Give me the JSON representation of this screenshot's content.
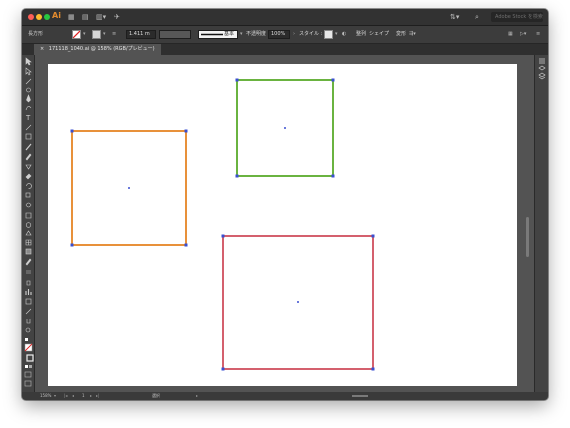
{
  "titlebar": {
    "app_logo": "Ai",
    "search_placeholder": "Adobe Stock を検索"
  },
  "control_bar": {
    "selection_label": "長方形",
    "stroke_weight": "1.411 m",
    "stroke_style": "基本",
    "opacity_label": "不透明度 :",
    "opacity_value": "100%",
    "style_label": "スタイル :",
    "align_label": "整列",
    "shape_label": "シェイプ",
    "transform_label": "変形"
  },
  "document": {
    "tab_title": "171118_1040.ai @ 158% (RGB/プレビュー)",
    "close_glyph": "×"
  },
  "status_bar": {
    "zoom": "158%",
    "artboard_number": "1",
    "tool_name": "選択"
  },
  "artwork": {
    "rectangles": [
      {
        "name": "orange-rectangle",
        "stroke": "#e8913a"
      },
      {
        "name": "green-rectangle",
        "stroke": "#6ab340"
      },
      {
        "name": "red-rectangle",
        "stroke": "#d4606d"
      }
    ],
    "anchor_color": "#3a4fd0"
  },
  "colors": {
    "close": "#fe5f57",
    "minimize": "#febc2e",
    "zoom": "#28c840"
  }
}
